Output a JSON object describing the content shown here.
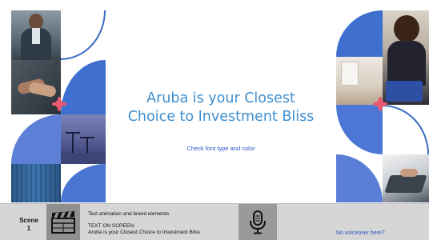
{
  "slide": {
    "headline_line1": "Aruba is your Closest",
    "headline_line2": "Choice to Investment Bliss",
    "note": "Check font type and color",
    "colors": {
      "headline": "#3e8fd0",
      "note": "#2d56c8",
      "accent_blue": "#3f6fcf",
      "sparkle": "#e85a71"
    }
  },
  "storyboard": {
    "scene_label": "Scene",
    "scene_number": "1",
    "clapper_icon": "clapperboard-icon",
    "animation_note": "Text animation and brand elements",
    "text_on_screen_label": "TEXT ON SCREEN:",
    "text_on_screen_value": "Aruba is your Closest Choice to Investment Bliss",
    "mic_icon": "microphone-icon",
    "voiceover_note": "No voiceover here?"
  }
}
